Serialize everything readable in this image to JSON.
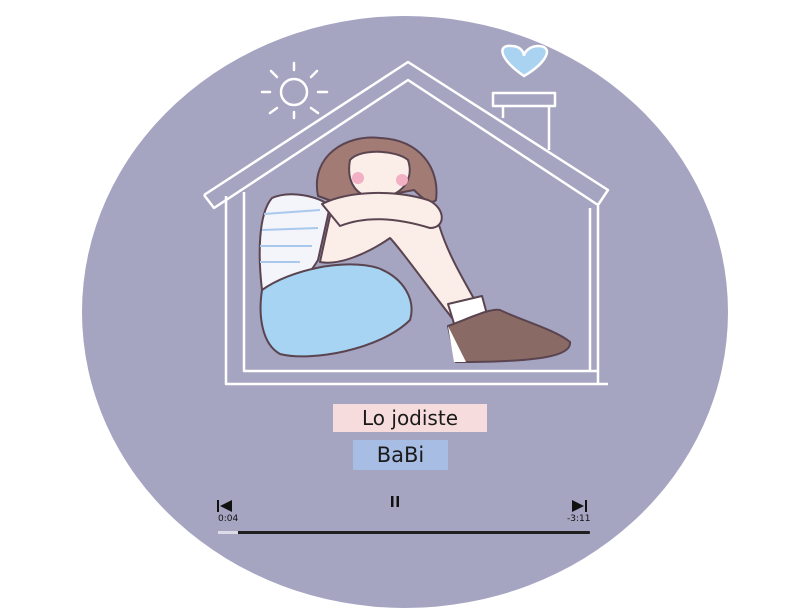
{
  "player": {
    "song_title": "Lo jodiste",
    "artist": "BaBi",
    "elapsed": "0:04",
    "remaining": "-3:11",
    "progress": 0.054,
    "state": "playing"
  },
  "controls": {
    "previous_icon": "skip-previous-icon",
    "pause_icon": "pause-icon",
    "next_icon": "skip-next-icon"
  },
  "colors": {
    "background_disc": "#a5a4c1",
    "title_pill": "#f6dcdc",
    "artist_pill": "#a8bde3",
    "heart": "#a9d3f0"
  }
}
